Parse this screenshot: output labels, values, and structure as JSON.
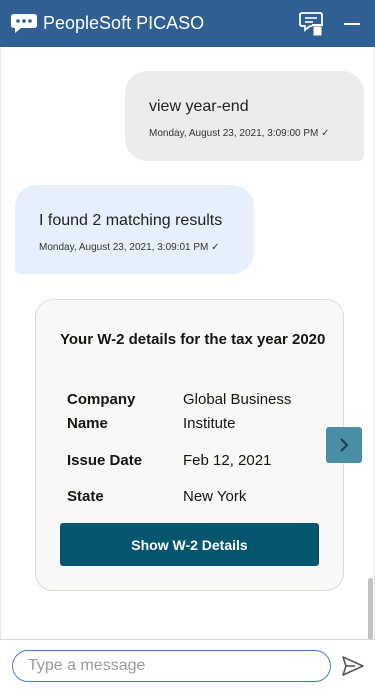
{
  "header": {
    "title": "PeopleSoft PICASO",
    "icons": {
      "logo": "chat-bubble-icon",
      "clear": "clear-conversation-icon",
      "minimize": "minimize-icon"
    }
  },
  "messages": [
    {
      "from": "user",
      "text": "view year-end",
      "timestamp": "Monday, August 23, 2021, 3:09:00 PM ✓"
    },
    {
      "from": "bot",
      "text": "I found 2 matching results",
      "timestamp": "Monday, August 23, 2021, 3:09:01 PM ✓"
    }
  ],
  "card": {
    "title": "Your W-2 details for the tax year 2020",
    "rows": [
      {
        "label": "Company Name",
        "value": "Global Business Institute"
      },
      {
        "label": "Issue Date",
        "value": "Feb 12, 2021"
      },
      {
        "label": "State",
        "value": "New York"
      }
    ],
    "button": "Show W-2 Details"
  },
  "carousel": {
    "next_icon": "chevron-right-icon"
  },
  "composer": {
    "placeholder": "Type a message",
    "value": "",
    "send_icon": "send-icon"
  },
  "colors": {
    "header_bg": "#2f5f93",
    "user_bubble": "#ececec",
    "bot_bubble": "#e6f0fc",
    "button_bg": "#04566f",
    "carousel_btn": "#4a8ea6"
  }
}
